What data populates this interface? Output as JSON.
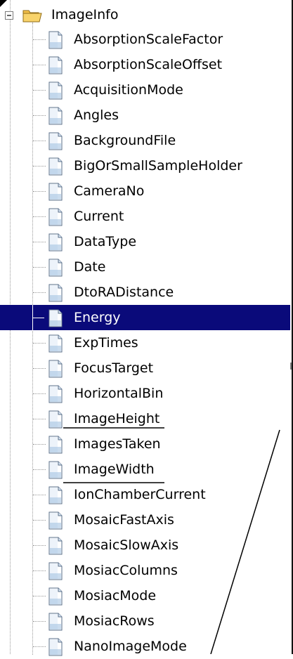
{
  "root": {
    "label": "ImageInfo",
    "expand_icon": "minus-expander-icon",
    "folder_icon": "open-folder-icon"
  },
  "items": [
    {
      "label": "AbsorptionScaleFactor",
      "selected": false
    },
    {
      "label": "AbsorptionScaleOffset",
      "selected": false
    },
    {
      "label": "AcquisitionMode",
      "selected": false
    },
    {
      "label": "Angles",
      "selected": false
    },
    {
      "label": "BackgroundFile",
      "selected": false
    },
    {
      "label": "BigOrSmallSampleHolder",
      "selected": false
    },
    {
      "label": "CameraNo",
      "selected": false
    },
    {
      "label": "Current",
      "selected": false
    },
    {
      "label": "DataType",
      "selected": false
    },
    {
      "label": "Date",
      "selected": false
    },
    {
      "label": "DtoRADistance",
      "selected": false
    },
    {
      "label": "Energy",
      "selected": true
    },
    {
      "label": "ExpTimes",
      "selected": false
    },
    {
      "label": "FocusTarget",
      "selected": false
    },
    {
      "label": "HorizontalBin",
      "selected": false
    },
    {
      "label": "ImageHeight",
      "selected": false
    },
    {
      "label": "ImagesTaken",
      "selected": false
    },
    {
      "label": "ImageWidth",
      "selected": false
    },
    {
      "label": "IonChamberCurrent",
      "selected": false
    },
    {
      "label": "MosaicFastAxis",
      "selected": false
    },
    {
      "label": "MosaicSlowAxis",
      "selected": false
    },
    {
      "label": "MosiacColumns",
      "selected": false
    },
    {
      "label": "MosiacMode",
      "selected": false
    },
    {
      "label": "MosiacRows",
      "selected": false
    },
    {
      "label": "NanoImageMode",
      "selected": false
    }
  ],
  "colors": {
    "selection_bg": "#0a0a7a",
    "selection_text": "#ffffff",
    "text": "#000000",
    "tree_line": "#999999"
  }
}
